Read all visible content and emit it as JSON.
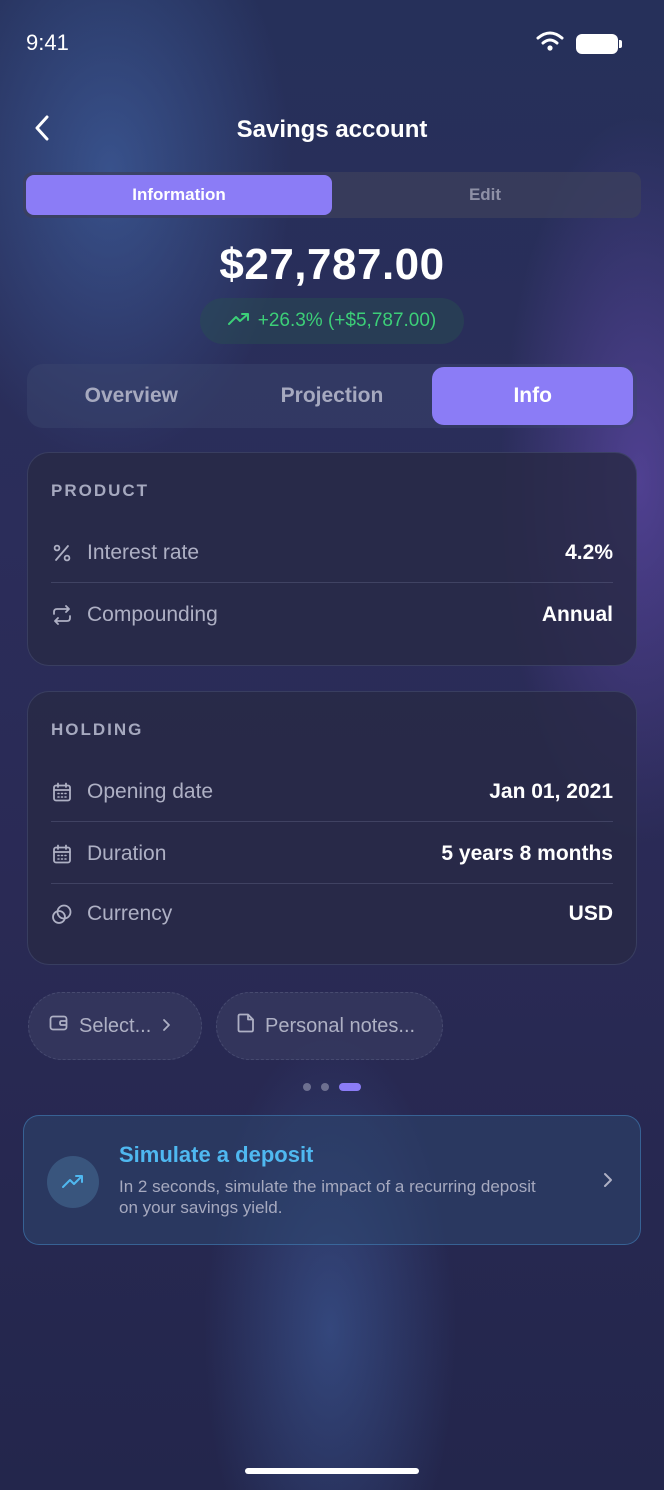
{
  "status_bar": {
    "time": "9:41"
  },
  "header": {
    "title": "Savings account"
  },
  "segment": {
    "options": [
      "Information",
      "Edit"
    ],
    "selected": "Information"
  },
  "balance": {
    "amount": "$27,787.00",
    "change": "+26.3% (+$5,787.00)"
  },
  "tabs": {
    "items": [
      "Overview",
      "Projection",
      "Info"
    ],
    "selected": "Info"
  },
  "product": {
    "label": "PRODUCT",
    "rows": [
      {
        "icon": "percent-icon",
        "label": "Interest rate",
        "value": "4.2%"
      },
      {
        "icon": "repeat-icon",
        "label": "Compounding",
        "value": "Annual"
      }
    ]
  },
  "holding": {
    "label": "HOLDING",
    "rows": [
      {
        "icon": "calendar-icon",
        "label": "Opening date",
        "value": "Jan 01, 2021"
      },
      {
        "icon": "calendar-icon",
        "label": "Duration",
        "value": "5 years 8 months"
      },
      {
        "icon": "coins-icon",
        "label": "Currency",
        "value": "USD"
      }
    ]
  },
  "chips": {
    "select": "Select...",
    "notes": "Personal notes..."
  },
  "pager": {
    "count": 3,
    "active": 3
  },
  "simulate": {
    "title": "Simulate a deposit",
    "description": "In 2 seconds, simulate the impact of a recurring deposit on your savings yield."
  },
  "colors": {
    "accent": "#8b7cf6",
    "positive": "#3ccf78",
    "link": "#4fb8f0"
  }
}
